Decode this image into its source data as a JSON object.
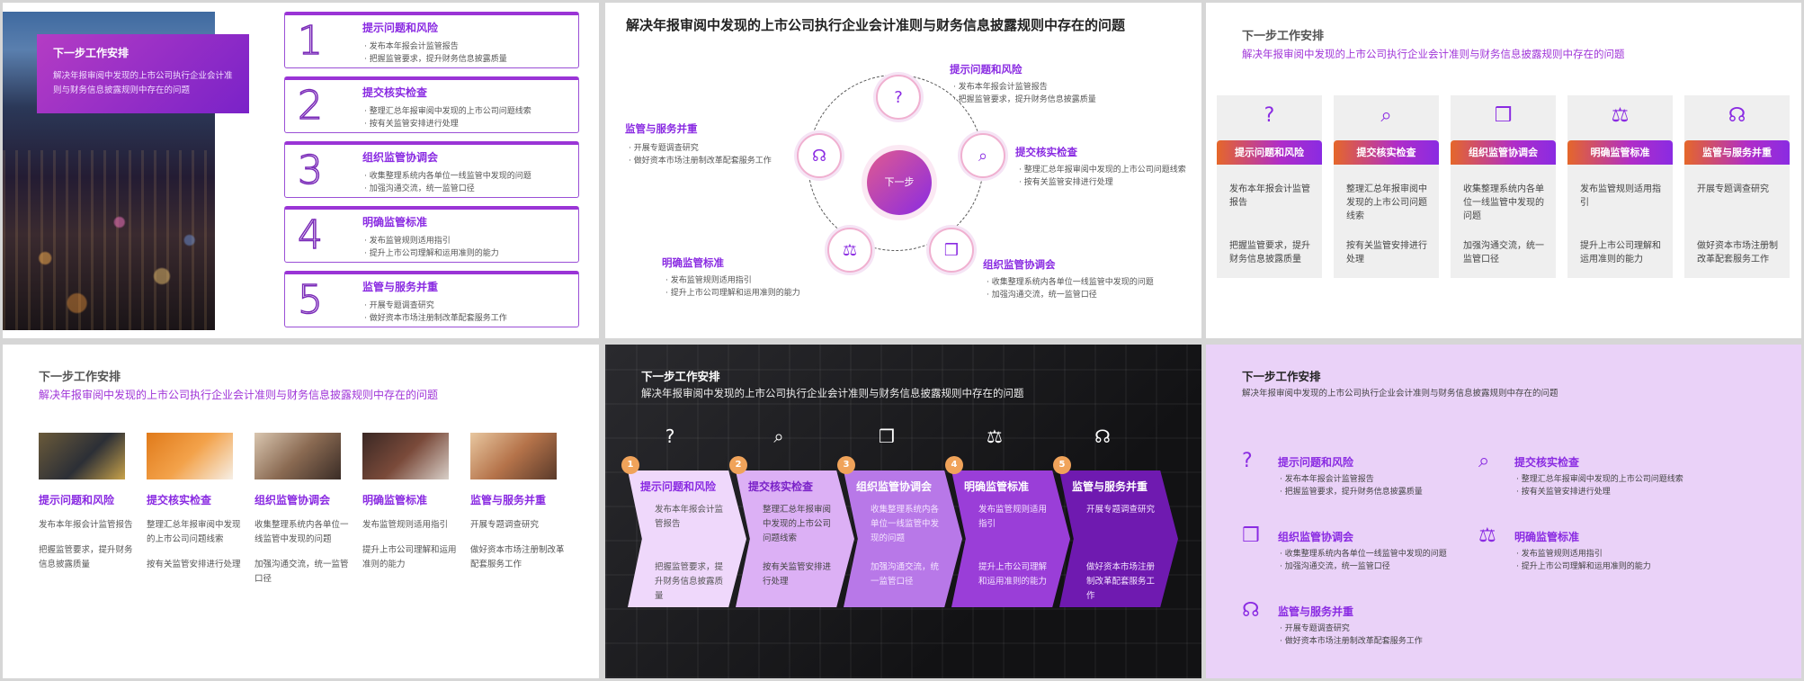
{
  "title": "下一步工作安排",
  "subtitle": "解决年报审阅中发现的上市公司执行企业会计准则与财务信息披露规则中存在的问题",
  "center_label": "下一步",
  "items": [
    {
      "num": "1",
      "title": "提示问题和风险",
      "icon": "question-icon",
      "b1": "发布本年报会计监管报告",
      "b2": "把握监管要求，提升财务信息披露质量",
      "short1": "发布本年报会计监管报告",
      "short2": "把握监管要求，提升财务信息披露质量"
    },
    {
      "num": "2",
      "title": "提交核实检查",
      "icon": "search-check-icon",
      "b1": "整理汇总年报审阅中发现的上市公司问题线索",
      "b2": "按有关监管安排进行处理",
      "short1": "整理汇总年报审阅中发现的上市公司问题线索",
      "short2": "按有关监管安排进行处理"
    },
    {
      "num": "3",
      "title": "组织监管协调会",
      "icon": "cubes-icon",
      "b1": "收集整理系统内各单位一线监管中发现的问题",
      "b2": "加强沟通交流，统一监管口径",
      "short1": "收集整理系统内各单位一线监管中发现的问题",
      "short2": "加强沟通交流，统一监管口径"
    },
    {
      "num": "4",
      "title": "明确监管标准",
      "icon": "scale-document-icon",
      "b1": "发布监管规则适用指引",
      "b2": "提升上市公司理解和运用准则的能力",
      "short1": "发布监管规则适用指引",
      "short2": "提升上市公司理解和运用准则的能力"
    },
    {
      "num": "5",
      "title": "监管与服务并重",
      "icon": "headset-icon",
      "b1": "开展专题调查研究",
      "b2": "做好资本市场注册制改革配套服务工作",
      "short1": "开展专题调查研究",
      "short2": "做好资本市场注册制改革配套服务工作"
    }
  ],
  "s2_items": [
    {
      "title": "提示问题和风险",
      "b1": "· 发布本年报会计监管报告",
      "b2": "· 把握监管要求，提升财务信息披露质量"
    },
    {
      "title": "提交核实检查",
      "b1": "· 整理汇总年报审阅中发现的上市公司问题线索",
      "b2": "· 按有关监管安排进行处理"
    },
    {
      "title": "组织监管协调会",
      "b1": "· 收集整理系统内各单位一线监管中发现的问题",
      "b2": "· 加强沟通交流，统一监管口径"
    },
    {
      "title": "明确监管标准",
      "b1": "· 发布监管规则适用指引",
      "b2": "· 提升上市公司理解和运用准则的能力"
    },
    {
      "title": "监管与服务并重",
      "b1": "· 开展专题调查研究",
      "b2": "· 做好资本市场注册制改革配套服务工作"
    }
  ],
  "colors": {
    "purple": "#8a2be2",
    "orange": "#e5672a",
    "pink": "#e05a90",
    "lavender": "#ead2f8"
  }
}
